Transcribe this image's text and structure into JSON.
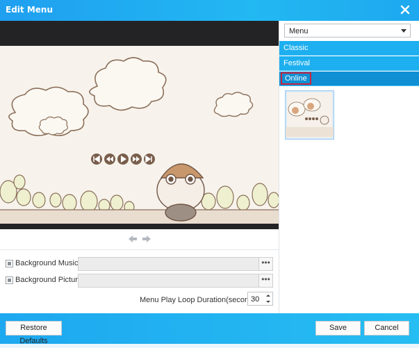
{
  "window": {
    "title": "Edit Menu"
  },
  "menu_panel": {
    "dropdown_value": "Menu",
    "categories": [
      {
        "label": "Classic",
        "selected": false
      },
      {
        "label": "Festival",
        "selected": false
      },
      {
        "label": "Online",
        "selected": true
      }
    ]
  },
  "settings": {
    "background_music_label": "Background Music:",
    "background_picture_label": "Background Picture:",
    "browse_glyph": "•••",
    "loop_label": "Menu Play Loop Duration(seconds):",
    "loop_value": "30"
  },
  "footer": {
    "restore_label": "Restore Defaults",
    "save_label": "Save",
    "cancel_label": "Cancel"
  },
  "colors": {
    "title_bar": "#22b8f2",
    "category_bg": "#1dafef",
    "category_selected": "#108fd4",
    "selection_outline": "#c7263f"
  }
}
